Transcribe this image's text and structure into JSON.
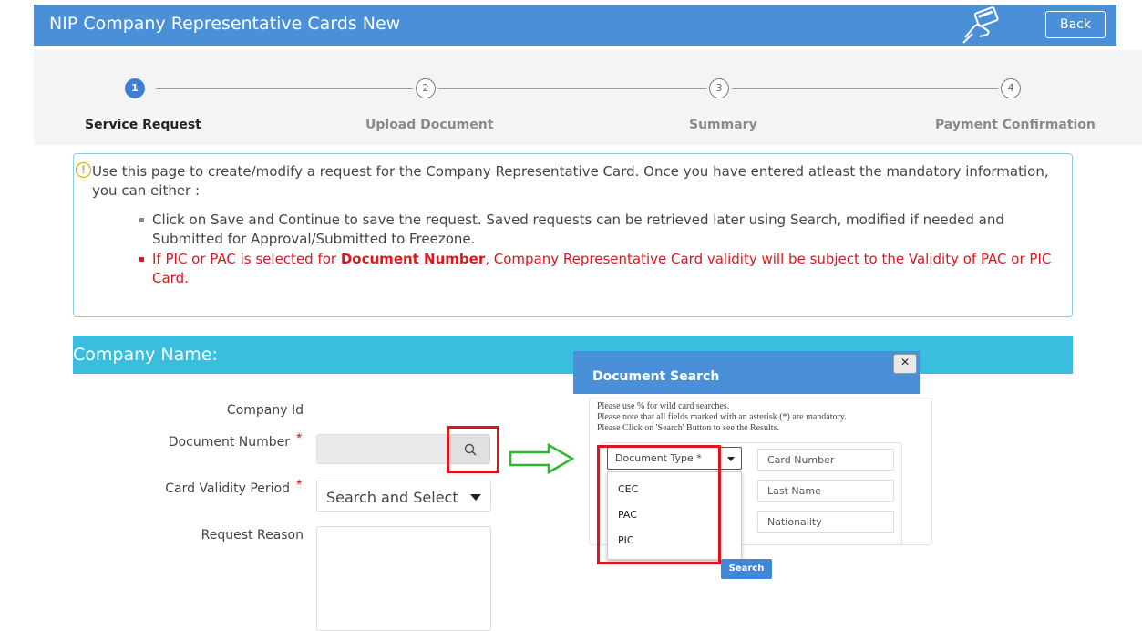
{
  "header": {
    "title": "NIP Company Representative Cards New",
    "back_label": "Back",
    "icon": "card-payment-icon"
  },
  "wizard": {
    "steps": [
      {
        "number": "1",
        "label": "Service Request",
        "active": true
      },
      {
        "number": "2",
        "label": "Upload Document",
        "active": false
      },
      {
        "number": "3",
        "label": "Summary",
        "active": false
      },
      {
        "number": "4",
        "label": "Payment Confirmation",
        "active": false
      }
    ]
  },
  "info": {
    "intro": "Use this page to create/modify a request for the Company Representative Card. Once you have entered atleast the mandatory information, you can either :",
    "bullet1": "Click on Save and Continue to save the request. Saved requests can be retrieved later using Search, modified if needed and Submitted for Approval/Submitted to Freezone.",
    "bullet2_pre": "If PIC or PAC is selected for ",
    "bullet2_bold": "Document Number",
    "bullet2_post": ", Company Representative Card validity will be subject to the Validity of PAC or PIC Card."
  },
  "form": {
    "section_title": "Company Name:",
    "company_id_label": "Company Id",
    "document_number_label": "Document Number",
    "card_validity_label": "Card Validity Period",
    "card_validity_value": "Search and Select",
    "request_reason_label": "Request Reason",
    "required_mark": "*"
  },
  "dialog": {
    "title": "Document Search",
    "close": "×",
    "note1": "Please use % for wild card searches.",
    "note2": "Please note that all fields marked with an asterisk (*) are mandatory.",
    "note3": "Please Click on 'Search' Button to see the Results.",
    "doc_type_placeholder": "Document Type *",
    "doc_type_options": [
      "CEC",
      "PAC",
      "PIC"
    ],
    "card_number_placeholder": "Card Number",
    "last_name_placeholder": "Last Name",
    "nationality_placeholder": "Nationality",
    "search_label": "Search"
  },
  "colors": {
    "header": "#4a90d9",
    "section": "#3bbde0",
    "required": "#e0151b",
    "annotation_red": "#e0151b",
    "annotation_green": "#2fb52f"
  }
}
